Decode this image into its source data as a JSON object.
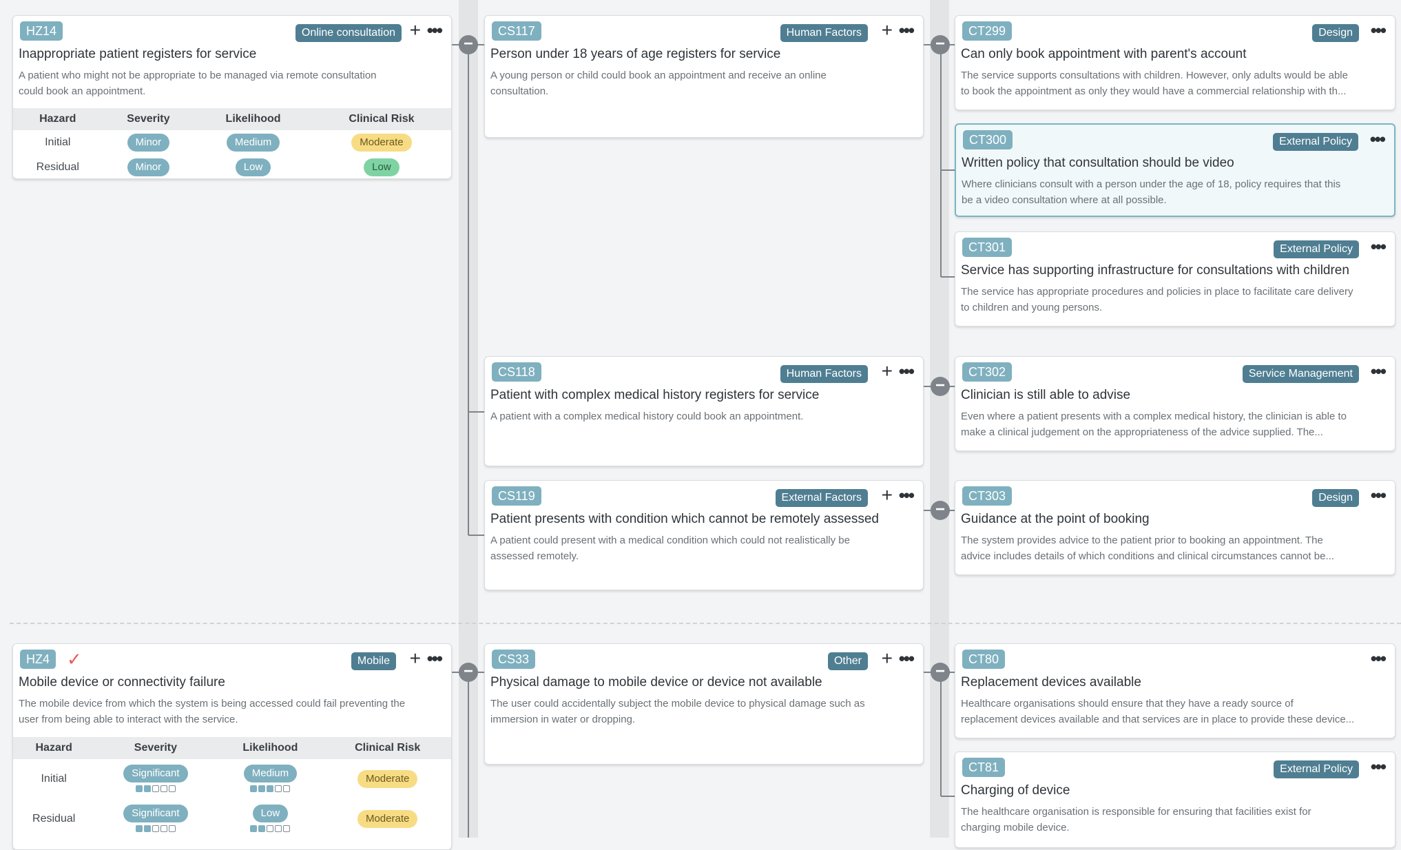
{
  "rows": [
    {
      "hazard": {
        "id": "HZ14",
        "category": "Online consultation",
        "title": "Inappropriate patient registers for service",
        "desc": [
          "A patient who might not be appropriate to be managed via remote consultation",
          "could book an appointment."
        ],
        "table": {
          "headers": [
            "Hazard",
            "Severity",
            "Likelihood",
            "Clinical Risk"
          ],
          "rows": [
            {
              "label": "Initial",
              "severity": "Minor",
              "likelihood": "Medium",
              "risk": "Moderate"
            },
            {
              "label": "Residual",
              "severity": "Minor",
              "likelihood": "Low",
              "risk": "Low"
            }
          ]
        }
      }
    },
    {
      "hazard": {
        "id": "HZ4",
        "category": "Mobile",
        "title": "Mobile device or connectivity failure",
        "desc": [
          "The mobile device from which the system is being accessed could fail preventing the",
          "user from being able to interact with the service."
        ],
        "table": {
          "headers": [
            "Hazard",
            "Severity",
            "Likelihood",
            "Clinical Risk"
          ],
          "rows": [
            {
              "label": "Initial",
              "severity": "Significant",
              "severity_level": 2,
              "likelihood": "Medium",
              "likelihood_level": 3,
              "risk": "Moderate"
            },
            {
              "label": "Residual",
              "severity": "Significant",
              "severity_level": 2,
              "likelihood": "Low",
              "likelihood_level": 2,
              "risk": "Moderate"
            }
          ]
        }
      }
    }
  ],
  "causes": [
    {
      "id": "CS117",
      "category": "Human Factors",
      "title": "Person under 18 years of age registers for service",
      "desc": [
        "A young person or child could book an appointment and receive an online",
        "consultation."
      ]
    },
    {
      "id": "CS118",
      "category": "Human Factors",
      "title": "Patient with complex medical history registers for service",
      "desc": [
        "A patient with a complex medical history could book an appointment."
      ]
    },
    {
      "id": "CS119",
      "category": "External Factors",
      "title": "Patient presents with condition which cannot be remotely assessed",
      "desc": [
        "A patient could present with a medical condition which could not realistically be",
        "assessed remotely."
      ]
    },
    {
      "id": "CS33",
      "category": "Other",
      "title": "Physical damage to mobile device or device not available",
      "desc": [
        "The user could accidentally subject the mobile device to physical damage such as",
        "immersion in water or dropping."
      ]
    }
  ],
  "controls": [
    {
      "id": "CT299",
      "category": "Design",
      "title": "Can only book appointment with parent's account",
      "desc": [
        "The service supports consultations with children. However, only adults would be able",
        "to book the appointment as only they would have a commercial relationship with th..."
      ]
    },
    {
      "id": "CT300",
      "category": "External Policy",
      "title": "Written policy that consultation should be video",
      "desc": [
        "Where clinicians consult with a person under the age of 18, policy requires that this",
        "be a video consultation where at all possible."
      ]
    },
    {
      "id": "CT301",
      "category": "External Policy",
      "title": "Service has supporting infrastructure for consultations with children",
      "desc": [
        "The service has appropriate procedures and policies in place to facilitate care delivery",
        "to children and young persons."
      ]
    },
    {
      "id": "CT302",
      "category": "Service Management",
      "title": "Clinician is still able to advise",
      "desc": [
        "Even where a patient presents with a complex medical history, the clinician is able to",
        "make a clinical judgement on the appropriateness of the advice supplied. The..."
      ]
    },
    {
      "id": "CT303",
      "category": "Design",
      "title": "Guidance at the point of booking",
      "desc": [
        "The system provides advice to the patient prior to booking an appointment. The",
        "advice includes details of which conditions and clinical circumstances cannot be..."
      ]
    },
    {
      "id": "CT80",
      "category": "",
      "title": "Replacement devices available",
      "desc": [
        "Healthcare organisations should ensure that they have a ready source of",
        "replacement devices available and that services are in place to provide these device..."
      ]
    },
    {
      "id": "CT81",
      "category": "External Policy",
      "title": "Charging of device",
      "desc": [
        "The healthcare organisation is responsible for ensuring that facilities exist for",
        "charging mobile device."
      ]
    }
  ],
  "icons": {
    "plus": "+",
    "more": "•••",
    "collapse": "−",
    "check": "✓"
  }
}
